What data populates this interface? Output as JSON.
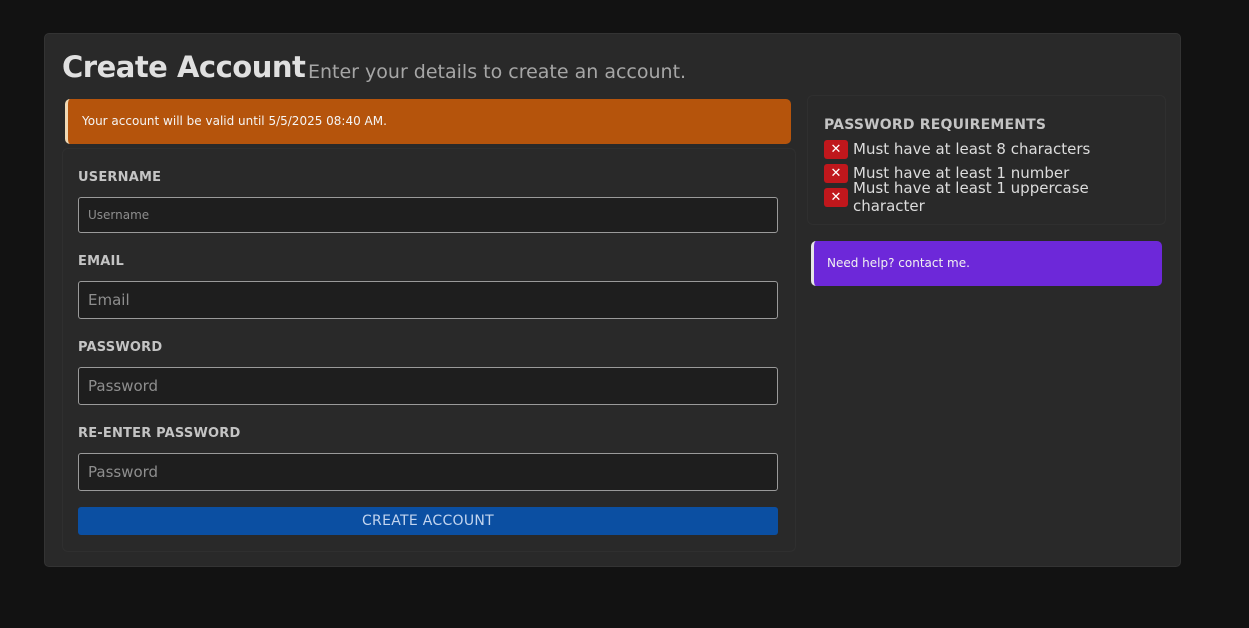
{
  "header": {
    "title": "Create Account",
    "subtitle": "Enter your details to create an account."
  },
  "notice": {
    "text": "Your account will be valid until 5/5/2025 08:40 AM."
  },
  "form": {
    "username": {
      "label": "USERNAME",
      "placeholder": "Username",
      "value": ""
    },
    "email": {
      "label": "EMAIL",
      "placeholder": "Email",
      "value": ""
    },
    "password": {
      "label": "PASSWORD",
      "placeholder": "Password",
      "value": ""
    },
    "repassword": {
      "label": "RE-ENTER PASSWORD",
      "placeholder": "Password",
      "value": ""
    },
    "submit_label": "CREATE ACCOUNT"
  },
  "requirements": {
    "title": "PASSWORD REQUIREMENTS",
    "status_icon": "x-icon",
    "status_glyph": "✕",
    "items": [
      {
        "text": "Must have at least 8 characters",
        "met": false
      },
      {
        "text": "Must have at least 1 number",
        "met": false
      },
      {
        "text": "Must have at least 1 uppercase character",
        "met": false
      }
    ]
  },
  "help": {
    "text": "Need help? contact me."
  },
  "colors": {
    "background": "#121212",
    "panel": "#292929",
    "notice": "#b5540c",
    "button": "#0b4fa2",
    "fail_badge": "#c0171c",
    "help": "#6d28d9"
  }
}
